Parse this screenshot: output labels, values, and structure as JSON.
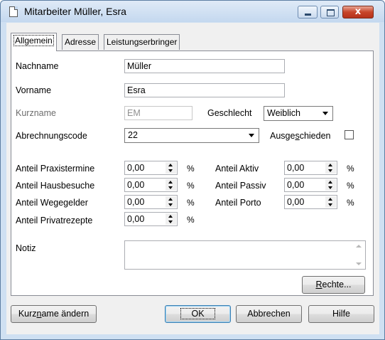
{
  "window": {
    "title": "Mitarbeiter Müller, Esra",
    "close_glyph": "x"
  },
  "tabs": [
    {
      "label": "Allgemein",
      "active": true
    },
    {
      "label": "Adresse",
      "active": false
    },
    {
      "label": "Leistungserbringer",
      "active": false
    }
  ],
  "form": {
    "nachname_label": "Nachname",
    "nachname_value": "Müller",
    "vorname_label": "Vorname",
    "vorname_value": "Esra",
    "kurzname_label": "Kurzname",
    "kurzname_value": "EM",
    "geschlecht_label": "Geschlecht",
    "geschlecht_value": "Weiblich",
    "abrechnungscode_label": "Abrechnungscode",
    "abrechnungscode_value": "22",
    "ausgeschieden_label_a": "Ausge",
    "ausgeschieden_label_u": "s",
    "ausgeschieden_label_b": "chieden",
    "ausgeschieden_checked": false,
    "percent_sign": "%",
    "anteil_praxistermine_label": "Anteil Praxistermine",
    "anteil_praxistermine_value": "0,00",
    "anteil_hausbesuche_label": "Anteil Hausbesuche",
    "anteil_hausbesuche_value": "0,00",
    "anteil_wegegelder_label": "Anteil Wegegelder",
    "anteil_wegegelder_value": "0,00",
    "anteil_privatrezepte_label": "Anteil Privatrezepte",
    "anteil_privatrezepte_value": "0,00",
    "anteil_aktiv_label": "Anteil Aktiv",
    "anteil_aktiv_value": "0,00",
    "anteil_passiv_label": "Anteil Passiv",
    "anteil_passiv_value": "0,00",
    "anteil_porto_label": "Anteil Porto",
    "anteil_porto_value": "0,00",
    "notiz_label": "Notiz",
    "notiz_value": ""
  },
  "buttons": {
    "rechte_u": "R",
    "rechte_rest": "echte...",
    "kurzname_a": "Kurz",
    "kurzname_u": "n",
    "kurzname_b": "ame ändern",
    "ok": "OK",
    "abbrechen": "Abbrechen",
    "hilfe": "Hilfe"
  }
}
